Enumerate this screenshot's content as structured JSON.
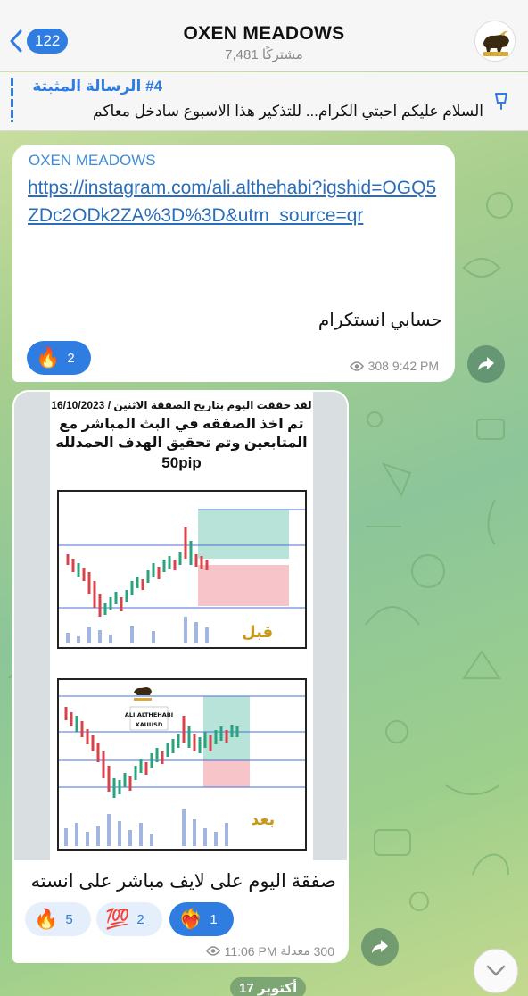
{
  "header": {
    "back_count": "122",
    "title": "OXEN MEADOWS",
    "subscribers": "7,481 مشتركًا"
  },
  "pinned": {
    "title": "#4 الرسالة المثبتة",
    "text": "السلام عليكم احبتي الكرام... للتذكير هذا الاسبوع سادخل معاكم"
  },
  "messages": [
    {
      "channel": "OXEN MEADOWS",
      "link": "https://instagram.com/ali.althehabi?igshid=OGQ5ZDc2ODk2ZA%3D%3D&utm_source=qr",
      "text": "حسابي انستكرام",
      "reactions": [
        {
          "icon": "fire",
          "count": "2",
          "selected": true
        }
      ],
      "views": "308",
      "time": "9:42 PM"
    },
    {
      "image": {
        "date_line": "لقد حققت اليوم بتاريخ الصفقة الاثنين / 16/10/2023",
        "line2": "تم اخذ الصفقه في البث المباشر مع",
        "line3": "المتابعين وتم تحقيق الهدف الحمدلله",
        "pip": "50pip",
        "before_label": "قبل",
        "after_label": "بعد",
        "watermark_name": "ALI.ALTHEHABI",
        "watermark_pair": "XAUUSD"
      },
      "caption": "صفقة اليوم على لايف مباشر على انسته",
      "reactions": [
        {
          "icon": "fire",
          "count": "5",
          "selected": false
        },
        {
          "icon": "100",
          "count": "2",
          "selected": false
        },
        {
          "icon": "heart-on-fire",
          "count": "1",
          "selected": true
        }
      ],
      "views": "300",
      "edited": "معدلة",
      "time": "11:06 PM"
    }
  ],
  "date_divider": "17 أكتوبر"
}
